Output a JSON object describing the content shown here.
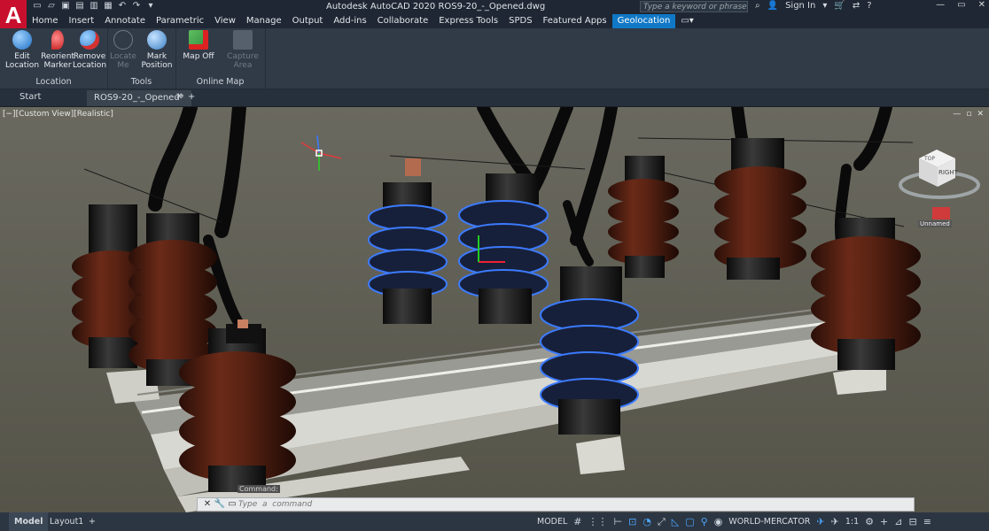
{
  "app": {
    "logo": "A",
    "title": "Autodesk AutoCAD 2020    ROS9-20_-_Opened.dwg"
  },
  "search": {
    "placeholder": "Type a keyword or phrase"
  },
  "account": {
    "sign_in": "Sign In",
    "help": "?"
  },
  "menu_tabs": [
    "Home",
    "Insert",
    "Annotate",
    "Parametric",
    "View",
    "Manage",
    "Output",
    "Add-ins",
    "Collaborate",
    "Express Tools",
    "SPDS",
    "Featured Apps",
    "Geolocation"
  ],
  "active_menu_tab": "Geolocation",
  "ribbon": {
    "location": {
      "title": "Location",
      "edit": "Edit\nLocation",
      "reorient": "Reorient\nMarker",
      "remove": "Remove\nLocation"
    },
    "tools": {
      "title": "Tools",
      "locate": "Locate\nMe",
      "mark": "Mark\nPosition"
    },
    "online_map": {
      "title": "Online Map",
      "map_off": "Map Off",
      "capture": "Capture\nArea"
    }
  },
  "doc_tabs": {
    "start": "Start",
    "active": "ROS9-20_-_Opened*",
    "add": "+"
  },
  "viewport": {
    "label": "[−][Custom View][Realistic]",
    "viewcube_labels": [
      "TOP",
      "RIGHT"
    ],
    "ucs_label": "Unnamed"
  },
  "command": {
    "label": "Command:",
    "placeholder": "Type  a  command"
  },
  "layouts": {
    "model": "Model",
    "layout1": "Layout1",
    "add": "+"
  },
  "status": {
    "model": "MODEL",
    "coordinate_system": "WORLD-MERCATOR",
    "scale": "1:1"
  },
  "colors": {
    "ribbon_bg": "#313b48",
    "active_tab": "#1078c6",
    "insulator": "#4a1c10",
    "selection": "#3c7bff"
  }
}
